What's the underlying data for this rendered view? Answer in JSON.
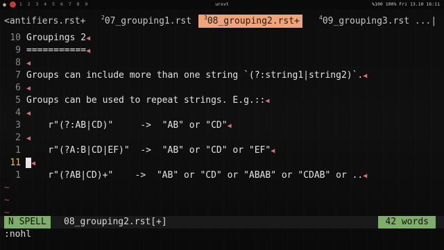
{
  "system_bar": {
    "workspaces": "1 2 3 4 5 6 7 8 9",
    "window_title": "urxvt",
    "status": "%100 100% Fri 13.10 16:11",
    "accent_color": "#c23a3a"
  },
  "tabs": [
    {
      "num": "",
      "label": "<antifiers.rst+",
      "active": false
    },
    {
      "num": "2",
      "label": "07_grouping1.rst",
      "active": false
    },
    {
      "num": "3",
      "label": "08_grouping2.rst+",
      "active": true
    },
    {
      "num": "4",
      "label": "09_grouping3.rst ...|",
      "active": false
    }
  ],
  "lines": [
    {
      "num": "10",
      "text": "Groupings 2",
      "eol": true
    },
    {
      "num": "9",
      "text": "===========",
      "eol": true
    },
    {
      "num": "8",
      "text": "",
      "eol": true
    },
    {
      "num": "7",
      "text": "Groups can include more than one string `(?:string1|string2)`.",
      "eol": true
    },
    {
      "num": "6",
      "text": "",
      "eol": true
    },
    {
      "num": "5",
      "text": "Groups can be used to repeat strings. E.g.::",
      "eol": true
    },
    {
      "num": "4",
      "text": "",
      "eol": true
    },
    {
      "num": "3",
      "text": "    r\"(?:AB|CD)\"     ->  \"AB\" or \"CD\"",
      "eol": true
    },
    {
      "num": "2",
      "text": "",
      "eol": true
    },
    {
      "num": "1",
      "text": "    r\"(?A:B|CD|EF)\"  ->  \"AB\" or \"CD\" or \"EF\"",
      "eol": true
    },
    {
      "num": "11",
      "text": "",
      "eol": true,
      "current": true
    },
    {
      "num": "1",
      "text": "    r\"(?AB|CD)+\"    ->  \"AB\" or \"CD\" or \"ABAB\" or \"CDAB\" or ..",
      "eol": true
    }
  ],
  "tildes": [
    "~",
    "~",
    "~"
  ],
  "statusline": {
    "mode": "N  SPELL",
    "filename": "08_grouping2.rst[+]",
    "words": "42 words",
    "mode_color": "#7fae6a"
  },
  "cmdline": ":nohl",
  "eol_marker": "◀",
  "icons": {
    "wifi": "wifi-icon",
    "workspace": "workspace-dot-icon"
  }
}
